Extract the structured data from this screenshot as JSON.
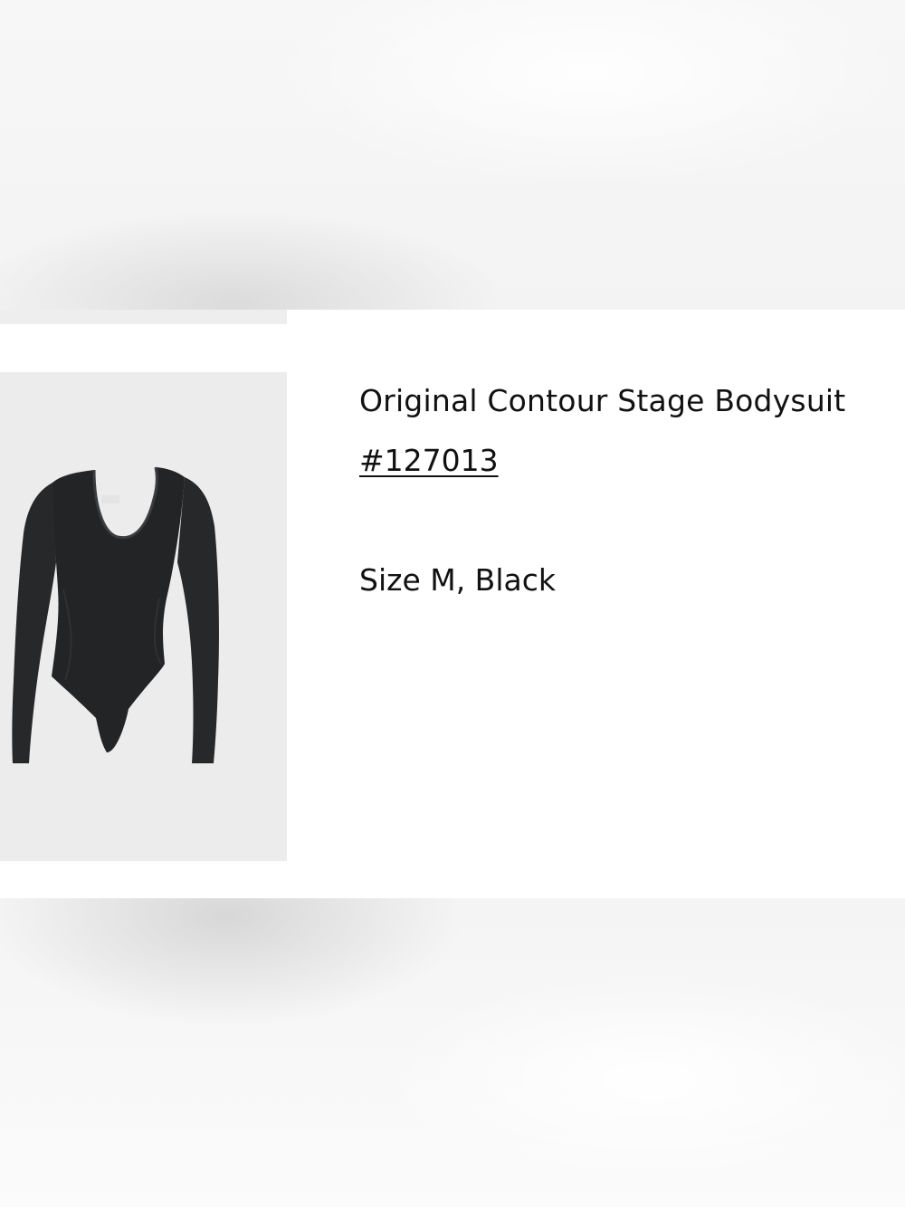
{
  "order_item": {
    "product_name": "Original Contour Stage Bodysuit",
    "order_number": "#127013",
    "variant": "Size M, Black",
    "image_label": "black long-sleeve scoop-neck bodysuit"
  },
  "colors": {
    "card_background": "#ffffff",
    "image_background": "#ececec",
    "garment": "#222426",
    "text": "#111111"
  }
}
